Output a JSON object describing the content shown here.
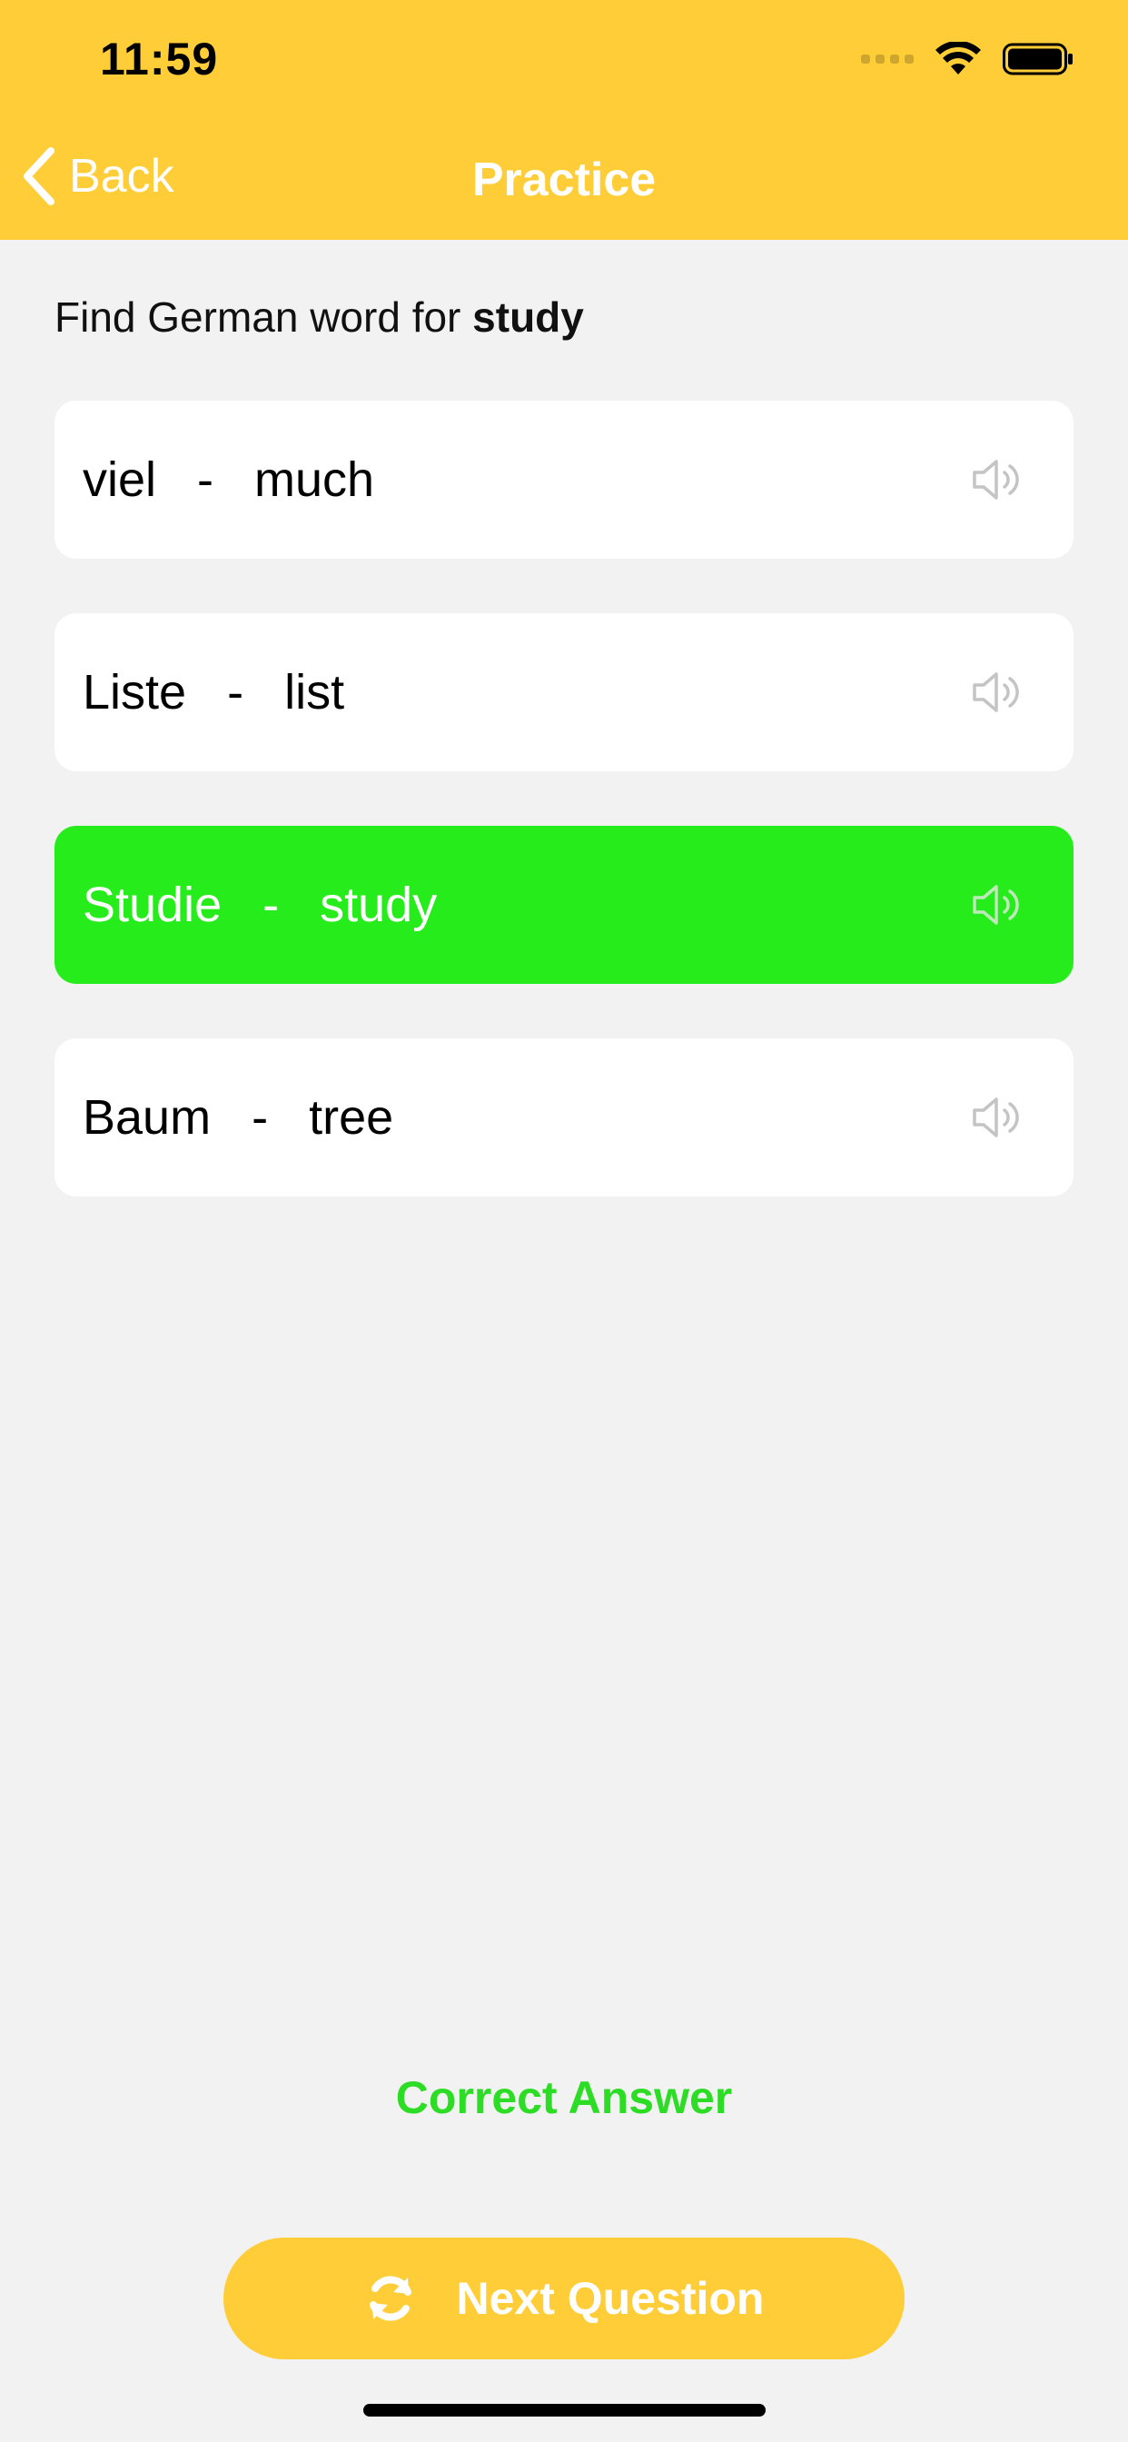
{
  "status_bar": {
    "time": "11:59"
  },
  "nav": {
    "back_label": "Back",
    "title": "Practice"
  },
  "question": {
    "prefix": "Find German word for ",
    "target_word": "study"
  },
  "options": [
    {
      "german": "viel",
      "separator": "-",
      "english": "much",
      "state": "default"
    },
    {
      "german": "Liste",
      "separator": "-",
      "english": "list",
      "state": "default"
    },
    {
      "german": "Studie",
      "separator": "-",
      "english": "study",
      "state": "correct"
    },
    {
      "german": "Baum",
      "separator": "-",
      "english": "tree",
      "state": "default"
    }
  ],
  "result": {
    "text": "Correct Answer"
  },
  "next_button": {
    "label": "Next Question",
    "icon": "refresh-icon"
  },
  "colors": {
    "accent_yellow": "#ffcd38",
    "correct_green": "#27ec1c",
    "result_green": "#2ddc25",
    "background": "#f2f2f2"
  }
}
